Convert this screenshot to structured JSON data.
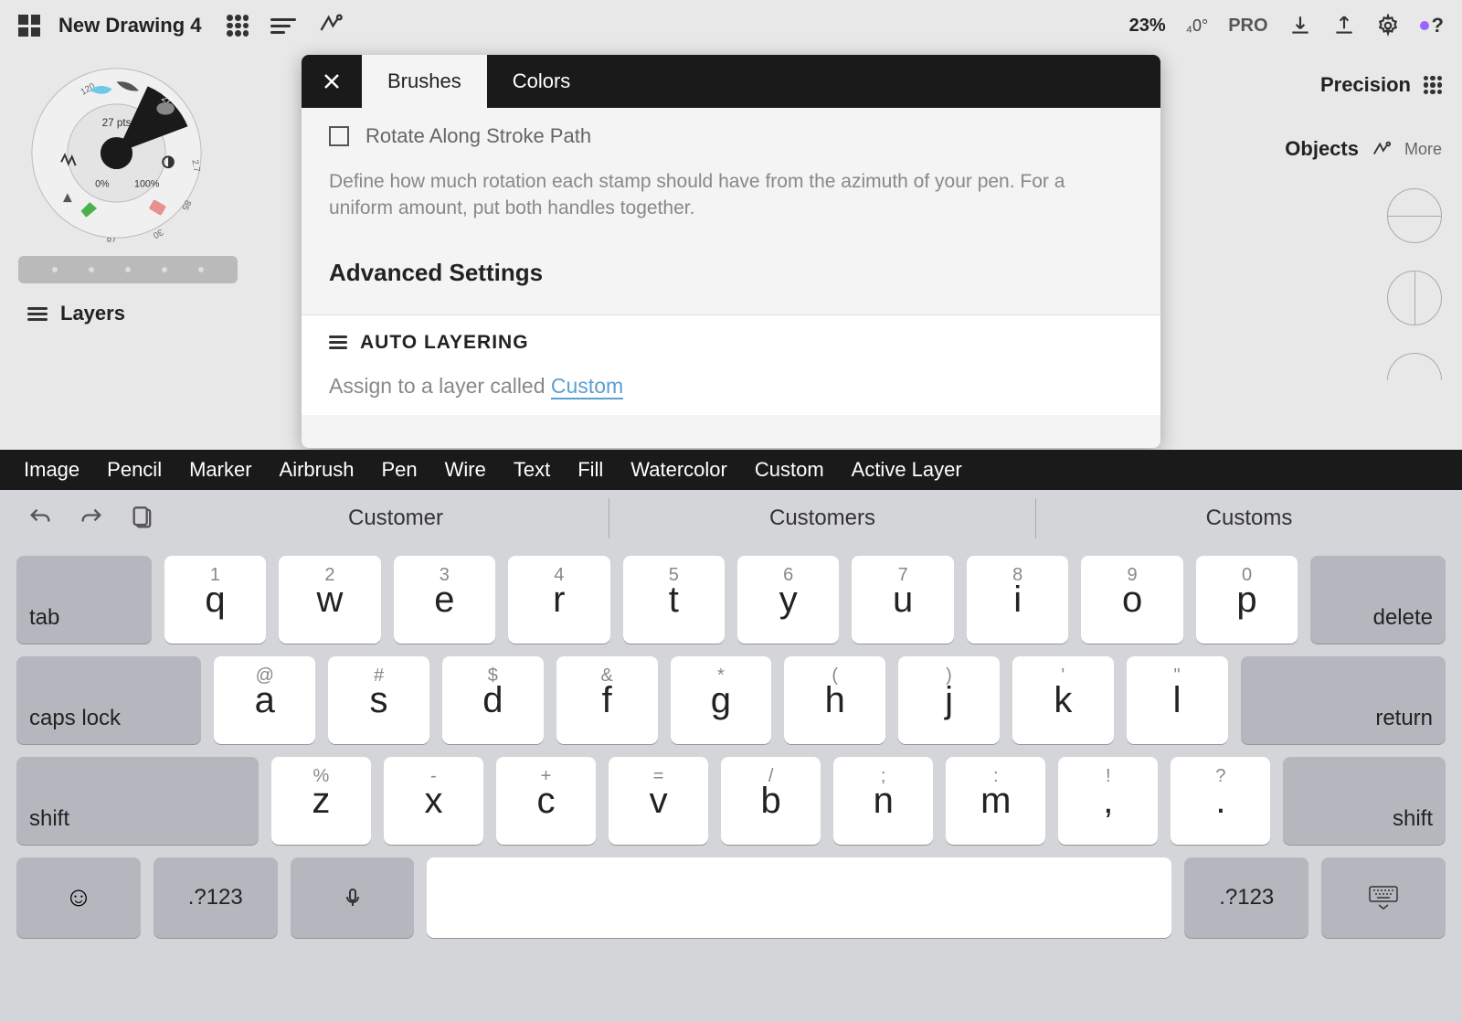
{
  "toolbar": {
    "title": "New Drawing 4",
    "zoom": "23%",
    "angle": "₄0°",
    "pro": "PRO"
  },
  "wheel": {
    "pts": "27 pts",
    "num120": "120",
    "num27": "27",
    "num27r": "2.7",
    "num85": "85",
    "num30": "30",
    "num78": "78",
    "pct0": "0%",
    "pct100": "100%"
  },
  "layers_label": "Layers",
  "modal": {
    "tab_brushes": "Brushes",
    "tab_colors": "Colors",
    "checkbox_label": "Rotate Along Stroke Path",
    "help": "Define how much rotation each stamp should have from the azimuth of your pen. For a uniform amount, put both handles together.",
    "section": "Advanced Settings",
    "auto_layering": "AUTO LAYERING",
    "assign_prefix": "Assign to a layer called ",
    "assign_value": "Custom"
  },
  "right": {
    "precision": "Precision",
    "objects": "Objects",
    "more": "More"
  },
  "suggestions": [
    "Image",
    "Pencil",
    "Marker",
    "Airbrush",
    "Pen",
    "Wire",
    "Text",
    "Fill",
    "Watercolor",
    "Custom",
    "Active Layer"
  ],
  "keyboard": {
    "predictions": [
      "Customer",
      "Customers",
      "Customs"
    ],
    "row1_sub": [
      "1",
      "2",
      "3",
      "4",
      "5",
      "6",
      "7",
      "8",
      "9",
      "0"
    ],
    "row1": [
      "q",
      "w",
      "e",
      "r",
      "t",
      "y",
      "u",
      "i",
      "o",
      "p"
    ],
    "row2_sub": [
      "@",
      "#",
      "$",
      "&",
      "*",
      "(",
      ")",
      "'",
      "\""
    ],
    "row2": [
      "a",
      "s",
      "d",
      "f",
      "g",
      "h",
      "j",
      "k",
      "l"
    ],
    "row3_sub": [
      "%",
      "-",
      "+",
      "=",
      "/",
      ";",
      ":",
      "!",
      "?"
    ],
    "row3": [
      "z",
      "x",
      "c",
      "v",
      "b",
      "n",
      "m",
      ",",
      "."
    ],
    "tab": "tab",
    "delete": "delete",
    "caps": "caps lock",
    "return": "return",
    "shift": "shift",
    "num": ".?123"
  }
}
